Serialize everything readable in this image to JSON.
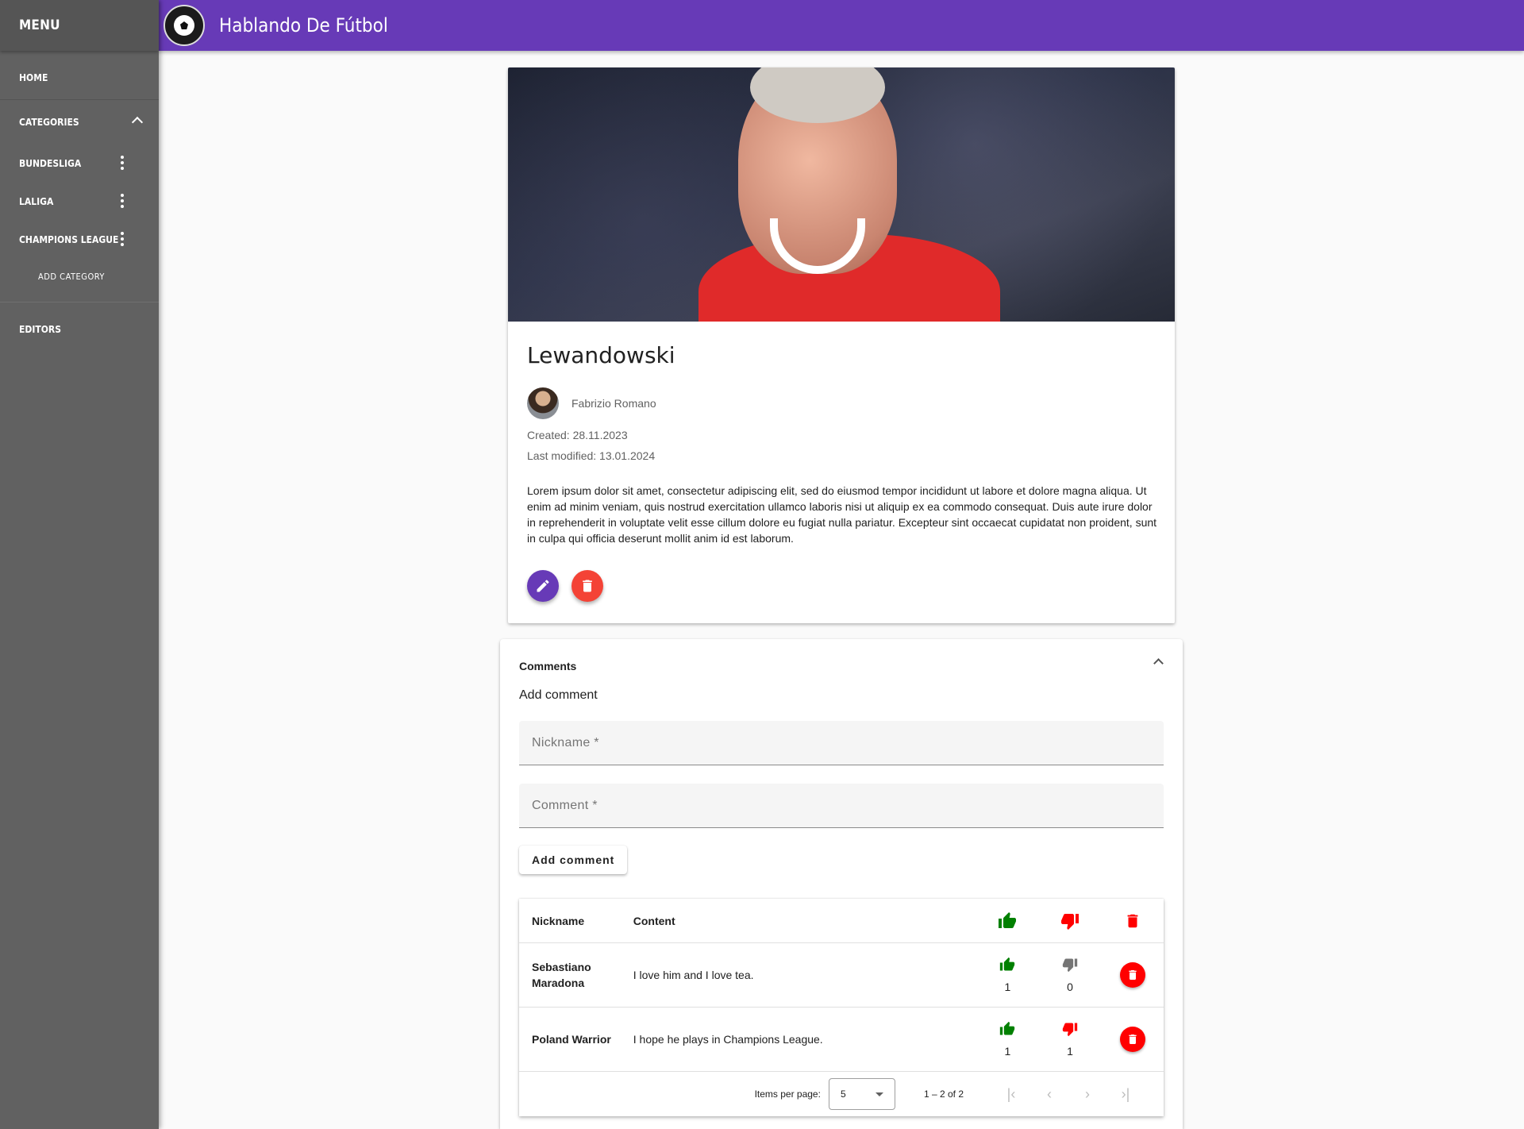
{
  "sidebar": {
    "title": "MENU",
    "home": "HOME",
    "categories": "CATEGORIES",
    "category_items": [
      {
        "label": "BUNDESLIGA"
      },
      {
        "label": "LALIGA"
      },
      {
        "label": "CHAMPIONS LEAGUE"
      }
    ],
    "add_category": "ADD CATEGORY",
    "editors": "EDITORS"
  },
  "header": {
    "title": "Hablando De Fútbol"
  },
  "article": {
    "title": "Lewandowski",
    "author": "Fabrizio Romano",
    "created": "Created: 28.11.2023",
    "modified": "Last modified: 13.01.2024",
    "content": "Lorem ipsum dolor sit amet, consectetur adipiscing elit, sed do eiusmod tempor incididunt ut labore et dolore magna aliqua. Ut enim ad minim veniam, quis nostrud exercitation ullamco laboris nisi ut aliquip ex ea commodo consequat. Duis aute irure dolor in reprehenderit in voluptate velit esse cillum dolore eu fugiat nulla pariatur. Excepteur sint occaecat cupidatat non proident, sunt in culpa qui officia deserunt mollit anim id est laborum."
  },
  "comments": {
    "title": "Comments",
    "add_label": "Add comment",
    "nickname_placeholder": "Nickname *",
    "comment_placeholder": "Comment *",
    "add_button": "Add comment",
    "table": {
      "col_nickname": "Nickname",
      "col_content": "Content",
      "rows": [
        {
          "nickname": "Sebastiano Maradona",
          "content": "I love him and I love tea.",
          "likes": "1",
          "dislikes": "0"
        },
        {
          "nickname": "Poland Warrior",
          "content": "I hope he plays in Champions League.",
          "likes": "1",
          "dislikes": "1"
        }
      ]
    },
    "paginator": {
      "items_per_page_label": "Items per page:",
      "items_per_page": "5",
      "range": "1 – 2 of 2"
    }
  },
  "colors": {
    "primary": "#673ab7",
    "sidebar": "#616161",
    "like": "#008000",
    "dislike": "#ff0000",
    "danger": "#f44336"
  }
}
